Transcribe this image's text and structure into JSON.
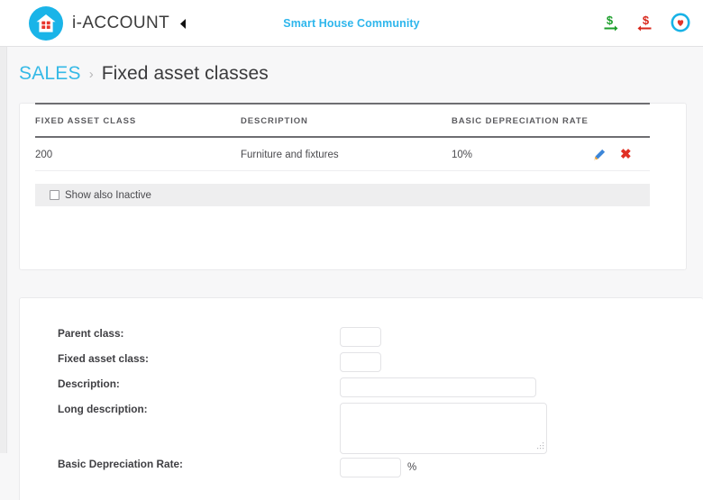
{
  "app": {
    "brand_prefix": "i-",
    "brand_suffix": "ACCOUNT",
    "community_title": "Smart House Community"
  },
  "topbar": {
    "sidebar_toggle_label": "◀",
    "icons": [
      {
        "name": "money-in-icon",
        "glyph": "$",
        "color": "#1c9e2b",
        "title": "Receive money"
      },
      {
        "name": "money-out-icon",
        "glyph": "$",
        "color": "#d8271b",
        "title": "Send money"
      },
      {
        "name": "favorites-icon",
        "glyph": "♥",
        "color": "#e0342a",
        "title": "Favourites"
      }
    ]
  },
  "breadcrumb": {
    "root": "SALES",
    "separator": "›",
    "current": "Fixed asset classes"
  },
  "table": {
    "columns": [
      "FIXED ASSET CLASS",
      "DESCRIPTION",
      "BASIC DEPRECIATION RATE",
      ""
    ],
    "rows": [
      {
        "fixed_asset_class": "200",
        "description": "Furniture and fixtures",
        "basic_depreciation_rate": "10%",
        "edit_label": "edit",
        "delete_label": "✖"
      }
    ],
    "show_inactive_label": "Show also Inactive",
    "show_inactive_checked": false
  },
  "form": {
    "fields": [
      {
        "label": "Parent class:",
        "value": "",
        "placeholder": "",
        "control": "input-small"
      },
      {
        "label": "Fixed asset class:",
        "value": "",
        "placeholder": "",
        "control": "input-small"
      },
      {
        "label": "Description:",
        "value": "",
        "placeholder": "",
        "control": "input-wide"
      },
      {
        "label": "Long description:",
        "value": "",
        "placeholder": "",
        "control": "textarea"
      },
      {
        "label": "Basic Depreciation Rate:",
        "value": "",
        "placeholder": "",
        "control": "input-rate",
        "suffix": "%"
      }
    ]
  },
  "colors": {
    "brand_cyan": "#1ab4e8",
    "link_cyan": "#35b9e6",
    "title_cyan": "#2eb6ec",
    "delete_red": "#e03024",
    "page_bg": "#f7f7f8"
  }
}
